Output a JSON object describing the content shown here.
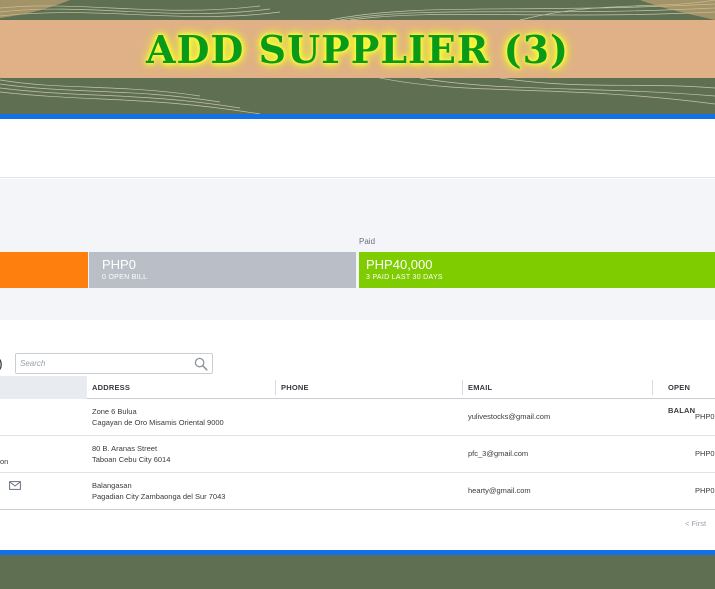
{
  "banner": {
    "title": "ADD SUPPLIER (3)"
  },
  "summary": {
    "paid_label": "Paid",
    "open_bill_amount": "PHP0",
    "open_bill_sub": "0 OPEN BILL",
    "paid_amount": "PHP40,000",
    "paid_sub": "3 PAID LAST 30 DAYS"
  },
  "toolbar": {
    "paren": ")",
    "search_placeholder": "Search"
  },
  "table": {
    "headers": {
      "address": "ADDRESS",
      "phone": "PHONE",
      "email": "EMAIL",
      "open_balance": "OPEN BALAN"
    },
    "rows": [
      {
        "name": "",
        "address_line1": "Zone 6 Bulua",
        "address_line2": "Cagayan de Oro Misamis Oriental 9000",
        "phone": "",
        "email": "yulivestocks@gmail.com",
        "balance": "PHP0"
      },
      {
        "name": "on",
        "address_line1": "80 B. Aranas Street",
        "address_line2": "Taboan Cebu City 6014",
        "phone": "",
        "email": "pfc_3@gmail.com",
        "balance": "PHP0"
      },
      {
        "name": "",
        "address_line1": "Balangasan",
        "address_line2": "Pagadian City Zambaonga del Sur 7043",
        "phone": "",
        "email": "hearty@gmail.com",
        "balance": "PHP0"
      }
    ]
  },
  "pagination": {
    "first": "< First"
  },
  "colors": {
    "orange": "#ff7f0e",
    "grey": "#babec6",
    "green": "#7fcc00",
    "blue": "#1470e6",
    "banner_bg": "#5f7052",
    "banner_strip": "#e0b187",
    "title": "#0a9a1a"
  },
  "icons": {
    "search": "search-icon",
    "mail": "mail-icon"
  }
}
